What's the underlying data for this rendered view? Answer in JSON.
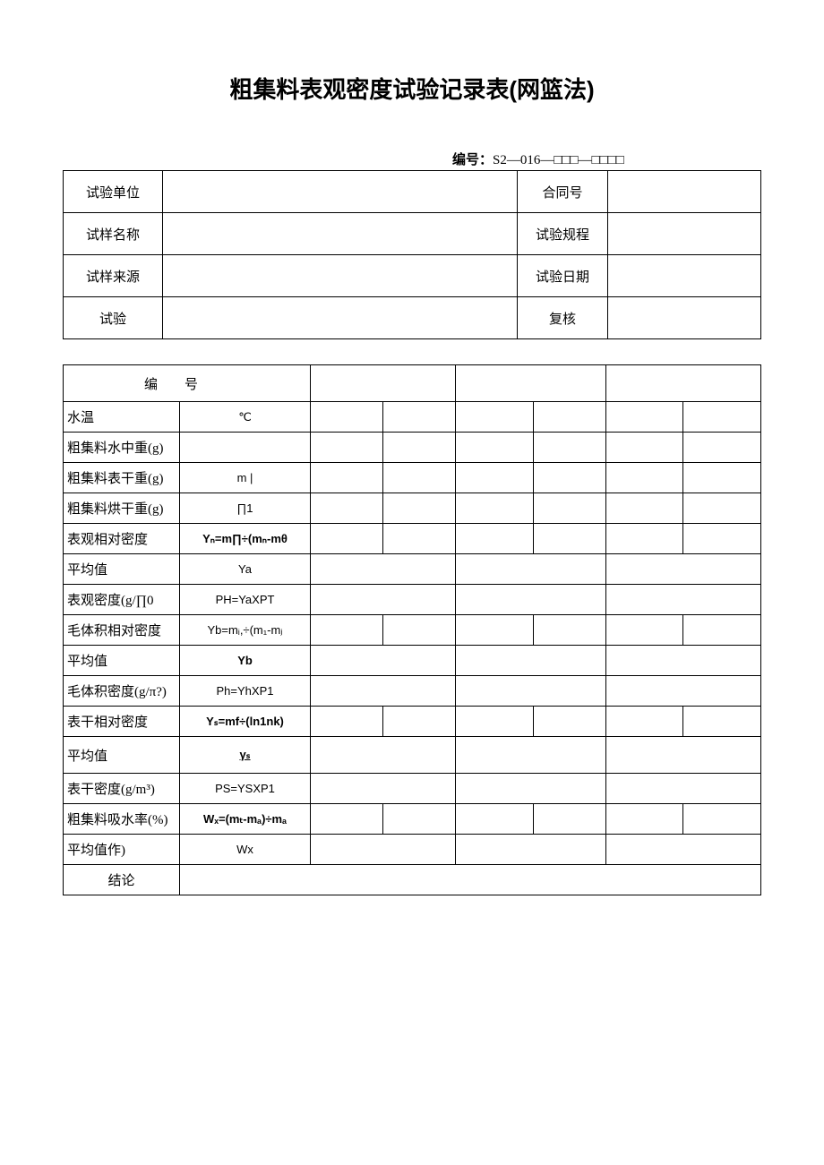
{
  "title": "粗集料表观密度试验记录表(网篮法)",
  "numbering_label": "编号：",
  "numbering_value": "S2—016—□□□—□□□□",
  "header": {
    "r1c1": "试验单位",
    "r1c2": "",
    "r1c3": "合同号",
    "r1c4": "",
    "r2c1": "试样名称",
    "r2c2": "",
    "r2c3": "试验规程",
    "r2c4": "",
    "r3c1": "试样来源",
    "r3c2": "",
    "r3c3": "试验日期",
    "r3c4": "",
    "r4c1": "试验",
    "r4c2": "",
    "r4c3": "复核",
    "r4c4": ""
  },
  "rows": {
    "serial_label": "编号",
    "water_temp": "水温",
    "water_temp_unit": "℃",
    "weight_in_water": "粗集料水中重(g)",
    "surface_dry": "粗集料表干重(g)",
    "surface_dry_sym": "m |",
    "oven_dry": "粗集料烘干重(g)",
    "oven_dry_sym": "∏1",
    "apparent_rel": "表观相对密度",
    "apparent_rel_formula": "Yₙ=m∏÷(mₙ-mθ",
    "avg1": "平均值",
    "avg1_sym": "Ya",
    "apparent_density": "表观密度(g/∏0",
    "apparent_density_formula": "PH=YaXPT",
    "bulk_rel": "毛体积相对密度",
    "bulk_rel_formula": "Yb=mᵢ,÷(m₁-mⱼ",
    "avg2": "平均值",
    "avg2_sym": "Yb",
    "bulk_density": "毛体积密度(g/π?)",
    "bulk_density_formula": "Ph=YhXP1",
    "ssd_rel": "表干相对密度",
    "ssd_rel_formula": "Yₛ=mf÷(ln1nk)",
    "avg3": "平均值",
    "avg3_sym": "γₛ",
    "ssd_density": "表干密度(g/m³)",
    "ssd_density_formula": "PS=YSXP1",
    "absorption": "粗集料吸水率(%)",
    "absorption_formula": "Wₓ=(mₜ-mₐ)÷mₐ",
    "avg4": "平均值作)",
    "avg4_sym": "Wx",
    "conclusion": "结论"
  }
}
